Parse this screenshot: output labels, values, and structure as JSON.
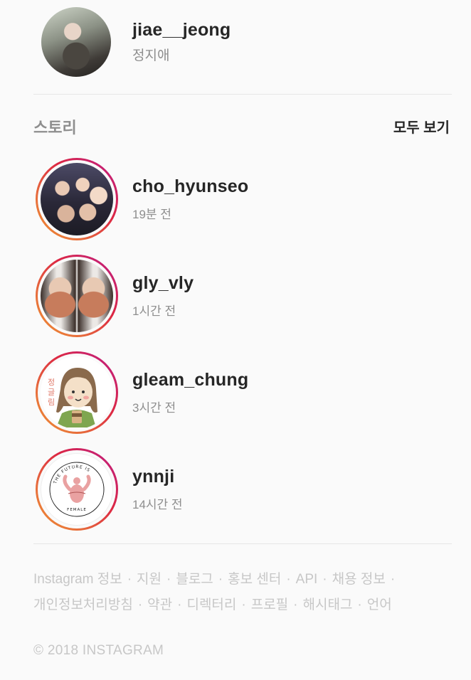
{
  "profile": {
    "username": "jiae__jeong",
    "fullname": "정지애"
  },
  "stories": {
    "title": "스토리",
    "see_all": "모두 보기",
    "items": [
      {
        "username": "cho_hyunseo",
        "time": "19분 전"
      },
      {
        "username": "gly_vly",
        "time": "1시간 전"
      },
      {
        "username": "gleam_chung",
        "time": "3시간 전"
      },
      {
        "username": "ynnji",
        "time": "14시간 전"
      }
    ]
  },
  "avatar_art": {
    "gleam_vertical": "정글림",
    "ynnji_badge": "THE FUTURE IS FEMALE"
  },
  "footer": {
    "links": [
      "Instagram 정보",
      "지원",
      "블로그",
      "홍보 센터",
      "API",
      "채용 정보",
      "개인정보처리방침",
      "약관",
      "디렉터리",
      "프로필",
      "해시태그",
      "언어"
    ],
    "separator": "·",
    "copyright": "© 2018 INSTAGRAM"
  },
  "colors": {
    "ring_start": "#f09433",
    "ring_end": "#bc1888",
    "text_primary": "#262626",
    "text_secondary": "#8e8e8e",
    "footer_text": "#c7c7c7"
  }
}
